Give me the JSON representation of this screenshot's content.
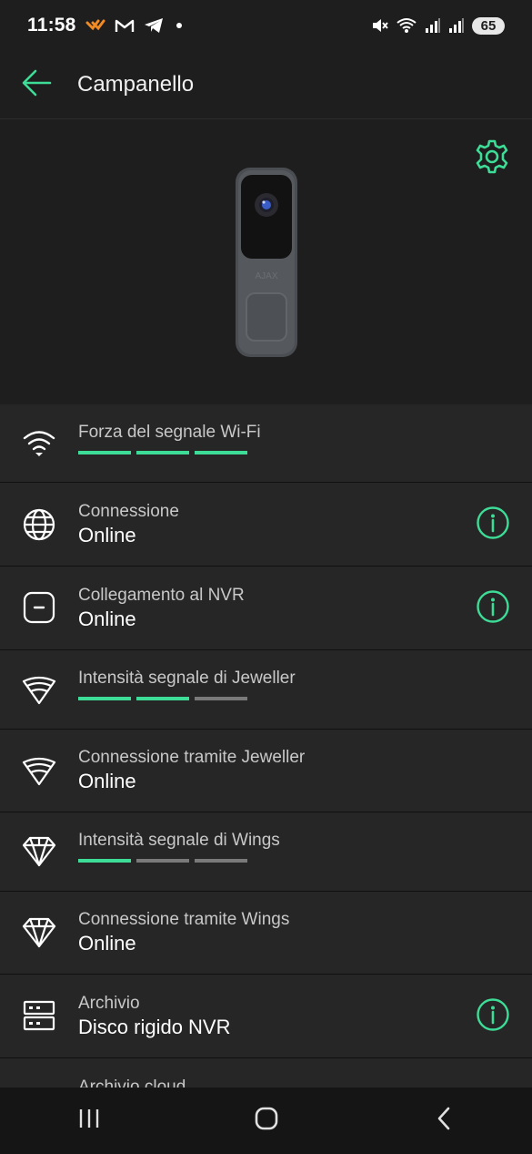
{
  "status_bar": {
    "time": "11:58",
    "battery": "65",
    "icons": [
      "app-notification-icon",
      "gmail-icon",
      "telegram-icon",
      "dot-icon",
      "mute-icon",
      "wifi-icon",
      "signal-icon",
      "signal-icon"
    ]
  },
  "appbar": {
    "title": "Campanello",
    "back_icon": "arrow-left-icon"
  },
  "hero": {
    "settings_icon": "gear-icon",
    "device_image": "doorbell-image"
  },
  "rows": [
    {
      "icon": "wifi-icon",
      "label": "Forza del segnale Wi-Fi",
      "signal_level": 3,
      "signal_max": 3
    },
    {
      "icon": "globe-icon",
      "label": "Connessione",
      "value": "Online",
      "info": true
    },
    {
      "icon": "nvr-icon",
      "label": "Collegamento al NVR",
      "value": "Online",
      "info": true
    },
    {
      "icon": "jeweller-icon",
      "label": "Intensità segnale di Jeweller",
      "signal_level": 2,
      "signal_max": 3
    },
    {
      "icon": "jeweller-icon",
      "label": "Connessione tramite Jeweller",
      "value": "Online"
    },
    {
      "icon": "wings-icon",
      "label": "Intensità segnale di Wings",
      "signal_level": 1,
      "signal_max": 3
    },
    {
      "icon": "wings-icon",
      "label": "Connessione tramite Wings",
      "value": "Online"
    },
    {
      "icon": "storage-icon",
      "label": "Archivio",
      "value": "Disco rigido NVR",
      "info": true
    },
    {
      "icon": "cloud-icon",
      "label": "Archivio cloud"
    }
  ],
  "colors": {
    "accent": "#3ddc97",
    "background": "#1e1e1e",
    "row_background": "#262626",
    "inactive_bar": "#7a7a7a"
  }
}
